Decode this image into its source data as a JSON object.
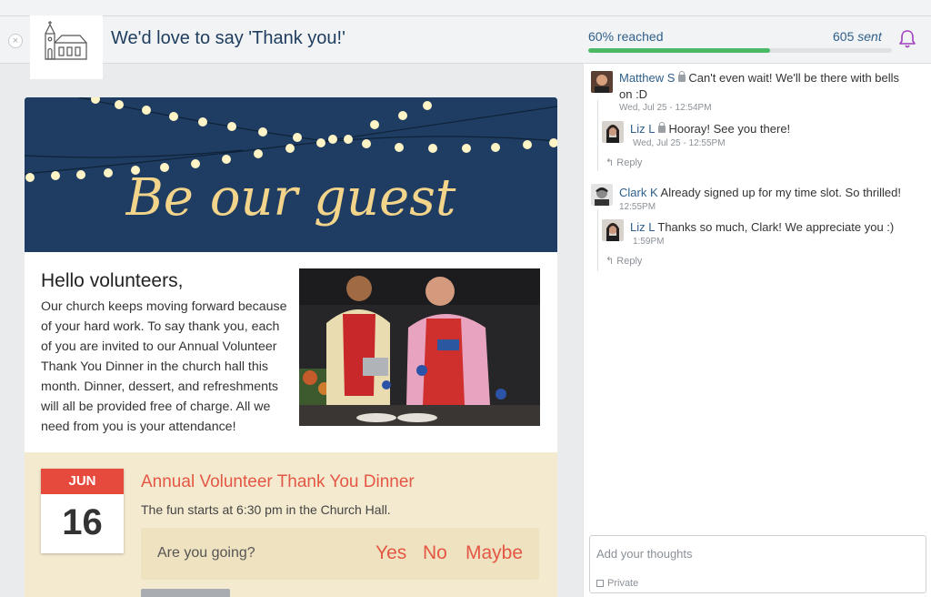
{
  "header": {
    "close_symbol": "×",
    "title": "We'd love to say 'Thank you!'",
    "reached_label": "60% reached",
    "progress_percent": 60,
    "sent_count": "605",
    "sent_word": "sent",
    "progress_color": "#4cb967",
    "bell_color": "#a13fbf"
  },
  "banner": {
    "text": "Be our guest",
    "background": "#1f3d62",
    "text_color": "#f3d48b"
  },
  "message": {
    "greeting": "Hello volunteers,",
    "body": "Our church keeps moving forward because of your hard work. To say thank you, each of you are invited to our Annual Volunteer Thank You Dinner in the church hall this month. Dinner, dessert, and refreshments will all be provided free of charge. All we need from you is your attendance!"
  },
  "event": {
    "month": "JUN",
    "day": "16",
    "title": "Annual Volunteer Thank You Dinner",
    "description": "The fun starts at 6:30 pm in the Church Hall.",
    "rsvp_question": "Are you going?",
    "rsvp_yes": "Yes",
    "rsvp_no": "No",
    "rsvp_maybe": "Maybe"
  },
  "comments": [
    {
      "name": "Matthew S",
      "text_line1": "Can't even wait! We'll be there with bells",
      "text_line2": "on :D",
      "time": "Wed, Jul 25 - 12:54PM",
      "reply": {
        "name": "Liz L",
        "text": "Hooray! See you there!",
        "time": "Wed, Jul 25 - 12:55PM"
      },
      "reply_label": "Reply"
    },
    {
      "name": "Clark K",
      "text": "Already signed up for my time slot. So thrilled!",
      "time": "12:55PM",
      "reply": {
        "name": "Liz L",
        "text": "Thanks so much, Clark! We appreciate you :)",
        "time": "1:59PM"
      },
      "reply_label": "Reply"
    }
  ],
  "composer": {
    "placeholder": "Add your thoughts",
    "private_label": "Private"
  }
}
